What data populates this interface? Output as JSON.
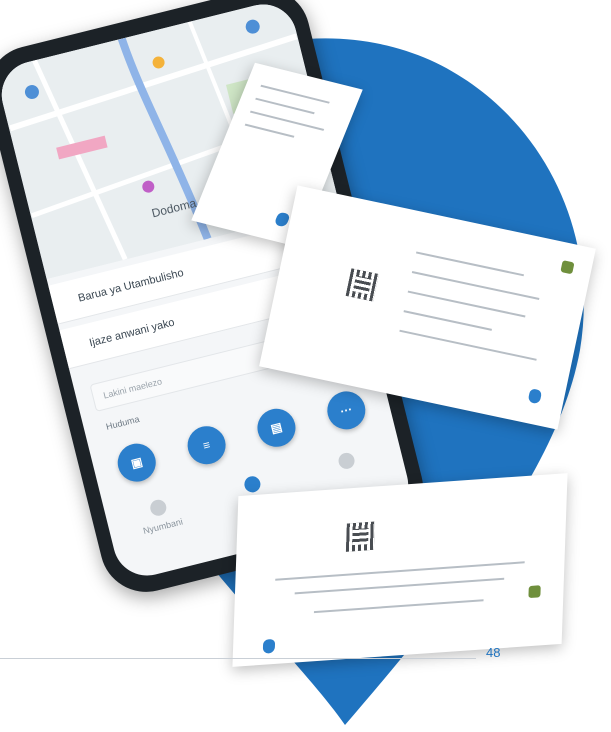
{
  "colors": {
    "accent": "#1f73bf",
    "blob": "#1f73bf",
    "button": "#2b7fcc"
  },
  "map": {
    "city_label": "Dodoma"
  },
  "form": {
    "field1": "Barua ya Utambulisho",
    "field2": "Ijaze anwani yako",
    "small_field": "Lakini maelezo",
    "section_label": "Huduma"
  },
  "services": [
    {
      "icon": "qr-icon",
      "glyph": "▣"
    },
    {
      "icon": "document-icon",
      "glyph": "≡"
    },
    {
      "icon": "id-icon",
      "glyph": "▤"
    },
    {
      "icon": "more-icon",
      "glyph": "···"
    }
  ],
  "nav": [
    {
      "icon": "home-icon",
      "label": "Nyumbani"
    },
    {
      "icon": "apps-icon",
      "label": ""
    },
    {
      "icon": "profile-icon",
      "label": ""
    }
  ],
  "page_number": "48"
}
